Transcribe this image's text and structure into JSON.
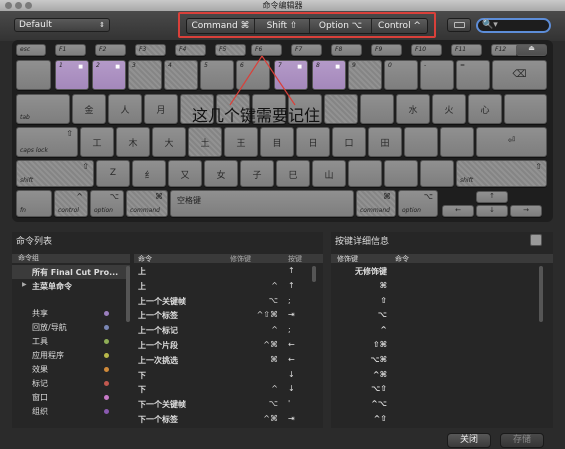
{
  "window": {
    "title": "命令编辑器"
  },
  "toolbar": {
    "preset": "Default",
    "modifiers": [
      "Command ⌘",
      "Shift ⇧",
      "Option ⌥",
      "Control ^"
    ],
    "search_placeholder": ""
  },
  "annotation": "这几个键需要记住",
  "keyboard": {
    "fn_row": [
      "esc",
      "F1",
      "F2",
      "F3",
      "F4",
      "F5",
      "F6",
      "F7",
      "F8",
      "F9",
      "F10",
      "F11",
      "F12"
    ],
    "number_row": [
      "",
      "1",
      "2",
      "3",
      "4",
      "5",
      "6",
      "7",
      "8",
      "9",
      "0",
      "-",
      "=",
      "⌫"
    ],
    "qwerty_row": [
      "tab",
      "",
      "人",
      "月",
      "",
      "",
      "",
      "",
      "",
      "",
      "水",
      "",
      "",
      "\\"
    ],
    "qwerty_cn": [
      "金",
      "人",
      "月",
      "",
      "",
      "",
      "",
      "",
      "",
      "水",
      "火",
      "心",
      ""
    ],
    "home_row": [
      "caps lock",
      "工",
      "木",
      "大",
      "土",
      "王",
      "目",
      "日",
      "口",
      "田",
      "",
      "",
      "⏎"
    ],
    "shift_row": [
      "shift",
      "Z",
      "纟",
      "又",
      "女",
      "子",
      "巳",
      "山",
      "",
      "",
      "",
      "shift"
    ],
    "bottom_row": [
      "fn",
      "control",
      "option",
      "command",
      "空格键",
      "command",
      "option"
    ]
  },
  "command_list": {
    "title": "命令列表",
    "group_header": "命令组",
    "groups": [
      "所有 Final Cut Pro...",
      "主菜单命令",
      "共享",
      "回放/导航",
      "工具",
      "应用程序",
      "效果",
      "标记",
      "窗口",
      "组织"
    ],
    "group_colors": [
      "#9b7fbf",
      "#7a87b5",
      "#8fae57",
      "#b8b84a",
      "#d08a3a",
      "#c2584f",
      "#c77ac7",
      "#8a5ab0"
    ],
    "headers": {
      "command": "命令",
      "modifier": "修饰键",
      "key": "按键"
    },
    "rows": [
      {
        "command": "上",
        "modifier": "",
        "key": "↑"
      },
      {
        "command": "上",
        "modifier": "^",
        "key": "↑"
      },
      {
        "command": "上一个关键帧",
        "modifier": "⌥",
        "key": ";"
      },
      {
        "command": "上一个标签",
        "modifier": "^⇧⌘",
        "key": "⇥"
      },
      {
        "command": "上一个标记",
        "modifier": "^",
        "key": ";"
      },
      {
        "command": "上一个片段",
        "modifier": "^⌘",
        "key": "←"
      },
      {
        "command": "上一次挑选",
        "modifier": "⌘",
        "key": "←"
      },
      {
        "command": "下",
        "modifier": "",
        "key": "↓"
      },
      {
        "command": "下",
        "modifier": "^",
        "key": "↓"
      },
      {
        "command": "下一个关键帧",
        "modifier": "⌥",
        "key": "'"
      },
      {
        "command": "下一个标签",
        "modifier": "^⌘",
        "key": "⇥"
      }
    ]
  },
  "key_detail": {
    "title": "按键详细信息",
    "headers": {
      "modifier": "修饰键",
      "command": "命令"
    },
    "rows": [
      "无修饰键",
      "⌘",
      "⇧",
      "⌥",
      "^",
      "⇧⌘",
      "⌥⌘",
      "^⌘",
      "⌥⇧",
      "^⌥",
      "^⇧"
    ]
  },
  "footer": {
    "close": "关闭",
    "save": "存储"
  }
}
